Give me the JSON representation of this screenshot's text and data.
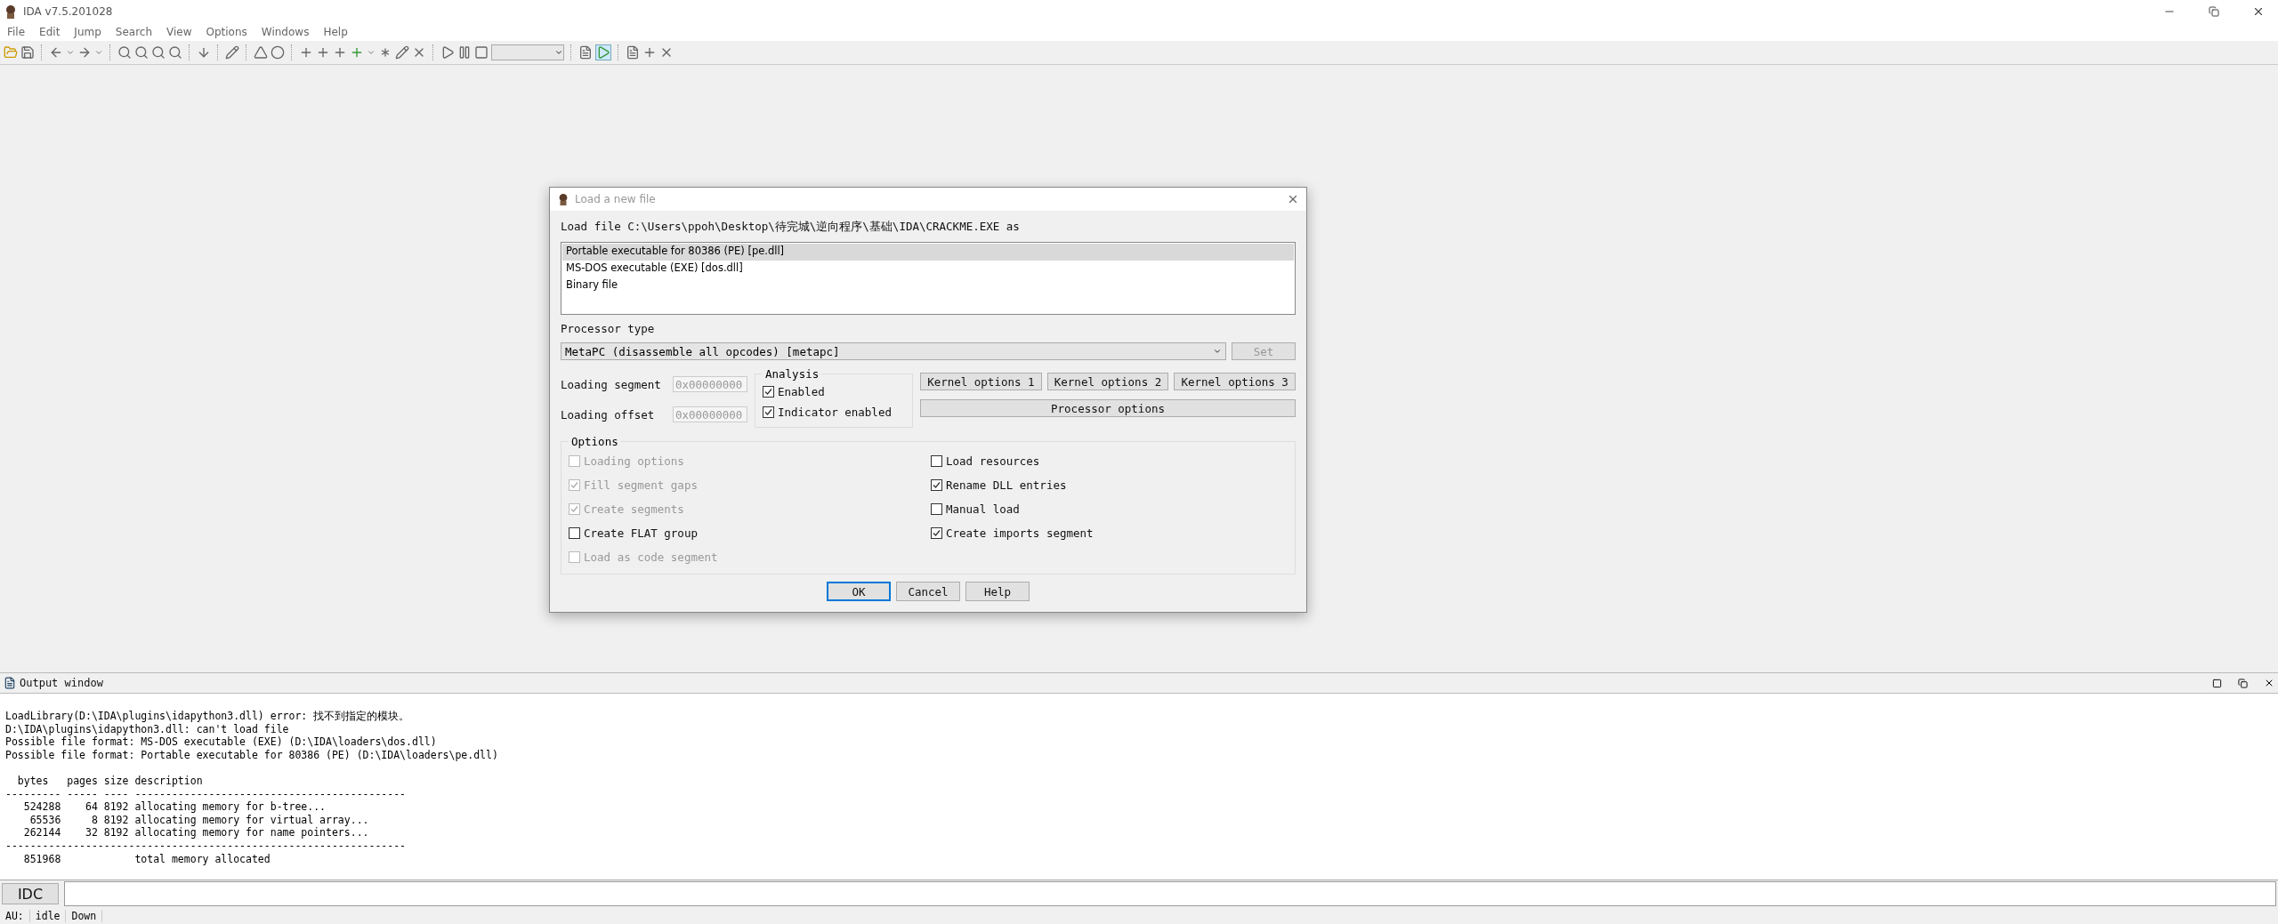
{
  "window": {
    "title": "IDA v7.5.201028"
  },
  "menu": [
    "File",
    "Edit",
    "Jump",
    "Search",
    "View",
    "Options",
    "Windows",
    "Help"
  ],
  "dialog": {
    "title": "Load a new file",
    "prompt": "Load file C:\\Users\\ppoh\\Desktop\\待完城\\逆向程序\\基础\\IDA\\CRACKME.EXE as",
    "formats": [
      {
        "label": "Portable executable for 80386 (PE) [pe.dll]",
        "selected": true
      },
      {
        "label": "MS-DOS executable (EXE) [dos.dll]",
        "selected": false
      },
      {
        "label": "Binary file",
        "selected": false
      }
    ],
    "processor_label": "Processor type",
    "processor": "MetaPC (disassemble all opcodes) [metapc]",
    "set_button": {
      "label": "Set",
      "disabled": true
    },
    "fields": [
      {
        "label": "Loading segment",
        "value": "0x00000000"
      },
      {
        "label": "Loading offset",
        "value": "0x00000000"
      }
    ],
    "analysis": {
      "title": "Analysis",
      "items": [
        {
          "label": "Enabled",
          "checked": true
        },
        {
          "label": "Indicator enabled",
          "checked": true
        }
      ]
    },
    "kernel_buttons": [
      "Kernel options 1",
      "Kernel options 2",
      "Kernel options 3"
    ],
    "processor_options": "Processor options",
    "options": {
      "title": "Options",
      "left": [
        {
          "label": "Loading options",
          "checked": false,
          "disabled": true
        },
        {
          "label": "Fill segment gaps",
          "checked": true,
          "disabled": true
        },
        {
          "label": "Create segments",
          "checked": true,
          "disabled": true
        },
        {
          "label": "Create FLAT group",
          "checked": false,
          "disabled": false
        },
        {
          "label": "Load as code segment",
          "checked": false,
          "disabled": true
        }
      ],
      "right": [
        {
          "label": "Load resources",
          "checked": false,
          "disabled": false
        },
        {
          "label": "Rename DLL entries",
          "checked": true,
          "disabled": false
        },
        {
          "label": "Manual load",
          "checked": false,
          "disabled": false
        },
        {
          "label": "Create imports segment",
          "checked": true,
          "disabled": false
        }
      ]
    },
    "buttons": [
      {
        "label": "OK",
        "default": true
      },
      {
        "label": "Cancel",
        "default": false
      },
      {
        "label": "Help",
        "default": false
      }
    ]
  },
  "output": {
    "title": "Output window",
    "blocks": [
      [
        "LoadLibrary(D:\\IDA\\plugins\\idapython3.dll) error: 找不到指定的模块。",
        "D:\\IDA\\plugins\\idapython3.dll: can't load file",
        "Possible file format: MS-DOS executable (EXE) (D:\\IDA\\loaders\\dos.dll)",
        "Possible file format: Portable executable for 80386 (PE) (D:\\IDA\\loaders\\pe.dll)"
      ],
      [
        "  bytes   pages size description",
        "--------- ----- ---- --------------------------------------------",
        "   524288    64 8192 allocating memory for b-tree...",
        "    65536     8 8192 allocating memory for virtual array...",
        "   262144    32 8192 allocating memory for name pointers...",
        "-----------------------------------------------------------------",
        "   851968            total memory allocated"
      ]
    ],
    "command_button": "IDC"
  },
  "status_bar": [
    "AU:",
    "idle",
    "Down"
  ]
}
